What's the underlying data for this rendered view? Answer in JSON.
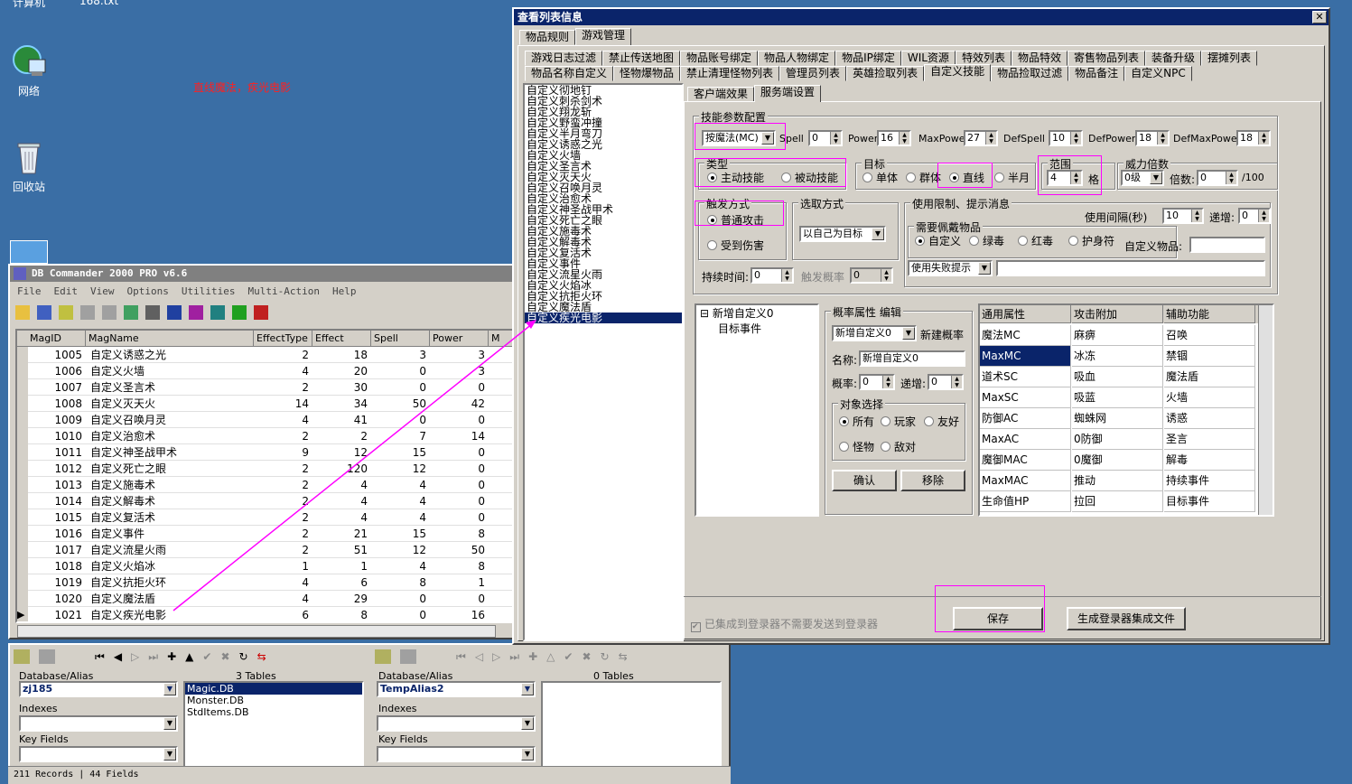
{
  "desktop": {
    "icon_network": "网络",
    "icon_recycle": "回收站",
    "top_text": "计算机",
    "top_text2": "168.txt",
    "red_note": "直线魔法，疾光电影"
  },
  "dbwin": {
    "title": "DB Commander 2000 PRO v6.6",
    "menu": [
      "File",
      "Edit",
      "View",
      "Options",
      "Utilities",
      "Multi-Action",
      "Help"
    ],
    "columns": [
      "MagID",
      "MagName",
      "EffectType",
      "Effect",
      "Spell",
      "Power",
      "M"
    ],
    "rows": [
      [
        "1005",
        "自定义诱惑之光",
        "2",
        "18",
        "3",
        "3"
      ],
      [
        "1006",
        "自定义火墙",
        "4",
        "20",
        "0",
        "3"
      ],
      [
        "1007",
        "自定义圣言术",
        "2",
        "30",
        "0",
        "0"
      ],
      [
        "1008",
        "自定义灭天火",
        "14",
        "34",
        "50",
        "42"
      ],
      [
        "1009",
        "自定义召唤月灵",
        "4",
        "41",
        "0",
        "0"
      ],
      [
        "1010",
        "自定义治愈术",
        "2",
        "2",
        "7",
        "14"
      ],
      [
        "1011",
        "自定义神圣战甲术",
        "9",
        "12",
        "15",
        "0"
      ],
      [
        "1012",
        "自定义死亡之眼",
        "2",
        "120",
        "12",
        "0"
      ],
      [
        "1013",
        "自定义施毒术",
        "2",
        "4",
        "4",
        "0"
      ],
      [
        "1014",
        "自定义解毒术",
        "2",
        "4",
        "4",
        "0"
      ],
      [
        "1015",
        "自定义复活术",
        "2",
        "4",
        "4",
        "0"
      ],
      [
        "1016",
        "自定义事件",
        "2",
        "21",
        "15",
        "8"
      ],
      [
        "1017",
        "自定义流星火雨",
        "2",
        "51",
        "12",
        "50"
      ],
      [
        "1018",
        "自定义火焰冰",
        "1",
        "1",
        "4",
        "8"
      ],
      [
        "1019",
        "自定义抗拒火环",
        "4",
        "6",
        "8",
        "1"
      ],
      [
        "1020",
        "自定义魔法盾",
        "4",
        "29",
        "0",
        "0"
      ],
      [
        "1021",
        "自定义疾光电影",
        "6",
        "8",
        "0",
        "16"
      ]
    ],
    "left_panel": {
      "db_label": "Database/Alias",
      "db_value": "zj185",
      "tables_count": "3 Tables",
      "tables": [
        "Magic.DB",
        "Monster.DB",
        "StdItems.DB"
      ],
      "indexes": "Indexes",
      "key_fields": "Key Fields"
    },
    "right_panel": {
      "db_label": "Database/Alias",
      "db_value": "TempAlias2",
      "tables_count": "0 Tables",
      "indexes": "Indexes",
      "key_fields": "Key Fields"
    },
    "status": {
      "records": "211 Records",
      "fields": "44 Fields"
    }
  },
  "listwin": {
    "title": "查看列表信息",
    "top_tabs": [
      "物品规则",
      "游戏管理"
    ],
    "tabs_row1": [
      "游戏日志过滤",
      "禁止传送地图",
      "物品账号绑定",
      "物品人物绑定",
      "物品IP绑定",
      "WIL资源",
      "特效列表",
      "物品特效",
      "寄售物品列表",
      "装备升级",
      "摆摊列表"
    ],
    "tabs_row2": [
      "物品名称自定义",
      "怪物爆物品",
      "禁止清理怪物列表",
      "管理员列表",
      "英雄捡取列表",
      "自定义技能",
      "物品捡取过滤",
      "物品备注",
      "自定义NPC"
    ],
    "skills": [
      "自定义彻地钉",
      "自定义刺杀剑术",
      "自定义翔龙斩",
      "自定义野蛮冲撞",
      "自定义半月弯刀",
      "自定义诱惑之光",
      "自定义火墙",
      "自定义圣言术",
      "自定义灭天火",
      "自定义召唤月灵",
      "自定义治愈术",
      "自定义神圣战甲术",
      "自定义死亡之眼",
      "自定义施毒术",
      "自定义解毒术",
      "自定义复活术",
      "自定义事件",
      "自定义流星火雨",
      "自定义火焰冰",
      "自定义抗拒火环",
      "自定义魔法盾",
      "自定义疾光电影"
    ],
    "sub_tabs": [
      "客户端效果",
      "服务端设置"
    ],
    "param": {
      "group": "技能参数配置",
      "mode": "按魔法(MC)",
      "spell_l": "Spell",
      "spell_v": "0",
      "power_l": "Power",
      "power_v": "16",
      "maxpower_l": "MaxPower",
      "maxpower_v": "27",
      "defspell_l": "DefSpell",
      "defspell_v": "10",
      "defpower_l": "DefPower",
      "defpower_v": "18",
      "defmaxpower_l": "DefMaxPower",
      "defmaxpower_v": "18"
    },
    "type": {
      "cap": "类型",
      "active": "主动技能",
      "passive": "被动技能"
    },
    "target": {
      "cap": "目标",
      "single": "单体",
      "group": "群体",
      "line": "直线",
      "half": "半月"
    },
    "range": {
      "cap": "范围",
      "value": "4",
      "unit": "格"
    },
    "mult": {
      "cap": "威力倍数",
      "level": "0级",
      "mult_l": "倍数:",
      "mult_v": "0",
      "suffix": "/100"
    },
    "trigger": {
      "cap": "触发方式",
      "normal": "普通攻击",
      "hurt": "受到伤害"
    },
    "pick": {
      "cap": "选取方式",
      "value": "以自己为目标"
    },
    "limit": {
      "cap": "使用限制、提示消息",
      "interval_l": "使用间隔(秒)",
      "interval_v": "10",
      "inc_l": "递增:",
      "inc_v": "0",
      "wear_cap": "需要佩戴物品",
      "custom": "自定义",
      "green": "绿毒",
      "red": "红毒",
      "amulet": "护身符",
      "custom_item": "自定义物品:",
      "fail": "使用失败提示"
    },
    "duration": {
      "label": "持续时间:",
      "value": "0",
      "trig_l": "触发概率",
      "trig_v": "0"
    },
    "tree": {
      "root": "新增自定义0",
      "child": "目标事件"
    },
    "prob": {
      "cap": "概率属性 编辑",
      "combo": "新增自定义0",
      "new": "新建概率",
      "name_l": "名称:",
      "name_v": "新增自定义0",
      "rate_l": "概率:",
      "rate_v": "0",
      "inc_l": "递增:",
      "inc_v": "0",
      "obj_cap": "对象选择",
      "all": "所有",
      "player": "玩家",
      "friend": "友好",
      "monster": "怪物",
      "enemy": "敌对",
      "ok": "确认",
      "remove": "移除"
    },
    "attr": {
      "headers": [
        "通用属性",
        "攻击附加",
        "辅助功能"
      ],
      "rows": [
        [
          "魔法MC",
          "麻痹",
          "召唤"
        ],
        [
          "MaxMC",
          "冰冻",
          "禁锢"
        ],
        [
          "道术SC",
          "吸血",
          "魔法盾"
        ],
        [
          "MaxSC",
          "吸蓝",
          "火墙"
        ],
        [
          "防御AC",
          "蜘蛛网",
          "诱惑"
        ],
        [
          "MaxAC",
          "0防御",
          "圣言"
        ],
        [
          "魔御MAC",
          "0魔御",
          "解毒"
        ],
        [
          "MaxMAC",
          "推动",
          "持续事件"
        ],
        [
          "生命值HP",
          "拉回",
          "目标事件"
        ]
      ]
    },
    "bottom": {
      "check": "已集成到登录器不需要发送到登录器",
      "save": "保存",
      "gen": "生成登录器集成文件"
    }
  },
  "colors": {
    "desktop": "#3a6ea5",
    "title": "#0a246a",
    "highlight": "#ff00ff",
    "select": "#0a246a"
  }
}
